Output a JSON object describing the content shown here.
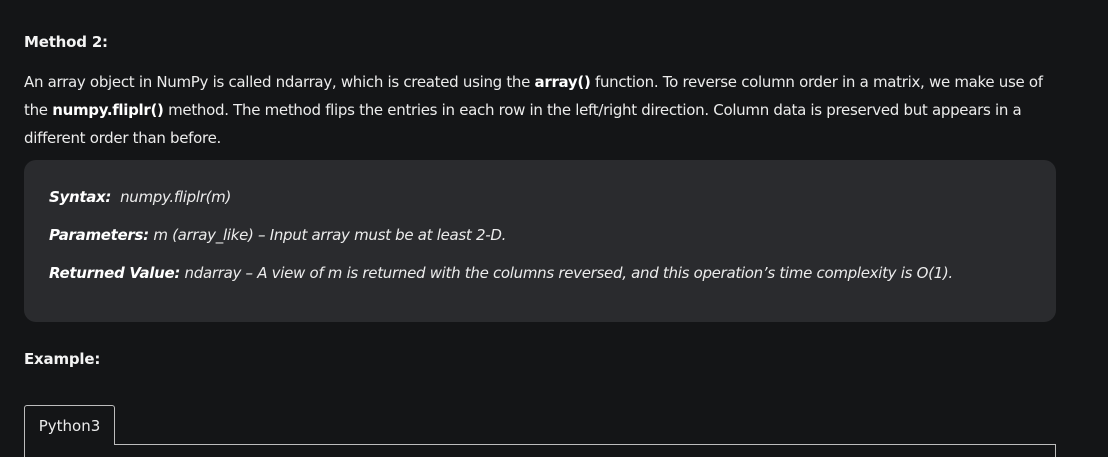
{
  "method_heading": "Method 2:",
  "paragraph": {
    "text1": "An array object in NumPy is called ndarray, which is created using the ",
    "code_array": "array()",
    "text2": " function. To reverse column order in a matrix, we make use of the ",
    "bold_method": "numpy.fliplr()",
    "text3": " method. The method flips the entries in each row in the left/right direction. Column data is preserved but appears in a different order than before."
  },
  "info_box": {
    "syntax_label": "Syntax:",
    "syntax_value": "  numpy.fliplr(m)",
    "parameters_label": "Parameters:",
    "parameters_value": " m (array_like) – Input array must be at least 2-D.",
    "returned_label": "Returned Value:",
    "returned_value": " ndarray – A view of m is returned with the columns reversed, and this operation’s time complexity is O(1)."
  },
  "example_heading": "Example:",
  "code_tab": {
    "label": "Python3"
  }
}
